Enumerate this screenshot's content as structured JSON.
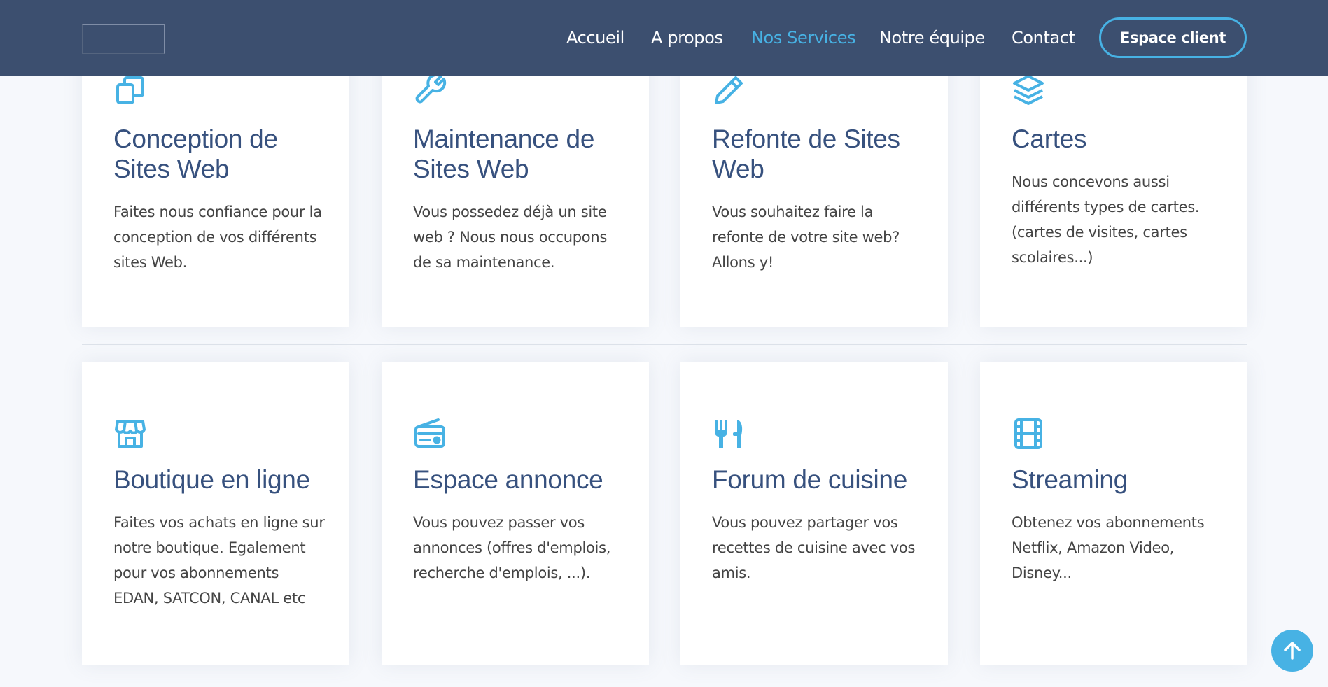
{
  "header": {
    "nav": [
      {
        "label": "Accueil"
      },
      {
        "label": "A propos"
      },
      {
        "label": "Nos Services"
      },
      {
        "label": "Notre équipe"
      },
      {
        "label": "Contact"
      }
    ],
    "active_nav": "Nos Services",
    "client_button": "Espace client"
  },
  "services": [
    {
      "icon": "copy-icon",
      "title": "Conception de Sites Web",
      "desc": "Faites nous confiance pour la conception de vos différents sites Web."
    },
    {
      "icon": "wrench-icon",
      "title": "Maintenance de Sites Web",
      "desc": "Vous possedez déjà un site web ? Nous nous occupons de sa maintenance."
    },
    {
      "icon": "pencil-icon",
      "title": "Refonte de Sites Web",
      "desc": "Vous souhaitez faire la refonte de votre site web? Allons y!"
    },
    {
      "icon": "layers-icon",
      "title": "Cartes",
      "desc": "Nous concevons aussi différents types de cartes. (cartes de visites, cartes scolaires...)"
    },
    {
      "icon": "store-icon",
      "title": "Boutique en ligne",
      "desc": "Faites vos achats en ligne sur notre boutique. Egalement pour vos abonnements EDAN, SATCON, CANAL etc"
    },
    {
      "icon": "radio-icon",
      "title": "Espace annonce",
      "desc": "Vous pouvez passer vos annonces (offres d'emplois, recherche d'emplois, ...)."
    },
    {
      "icon": "utensils-icon",
      "title": "Forum de cuisine",
      "desc": "Vous pouvez partager vos recettes de cuisine avec vos amis."
    },
    {
      "icon": "film-icon",
      "title": "Streaming",
      "desc": "Obtenez vos abonnements Netflix, Amazon Video, Disney..."
    }
  ],
  "scroll_top": {
    "icon": "arrow-up-icon"
  },
  "colors": {
    "header_bg": "#3c4f6f",
    "accent": "#47b2e4",
    "title": "#37517e",
    "text": "#444444",
    "page_bg": "#f6f8fc"
  }
}
